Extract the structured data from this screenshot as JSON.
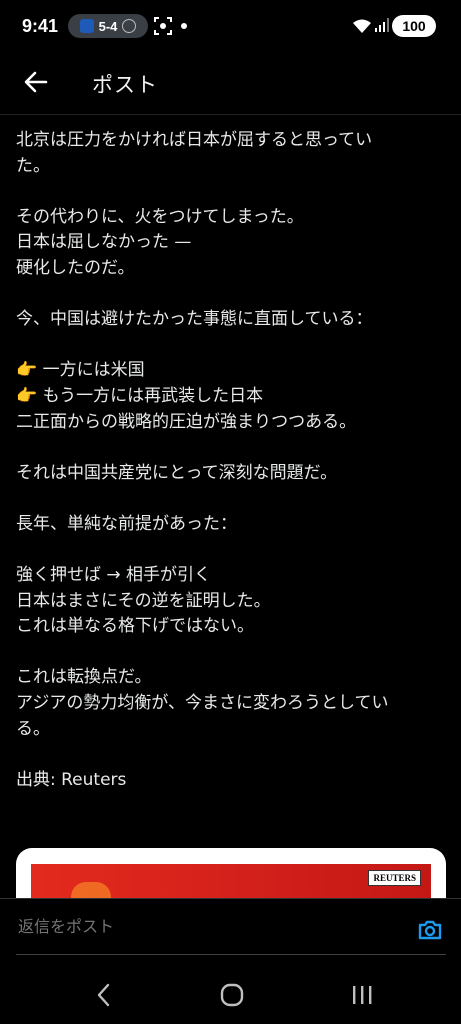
{
  "status_bar": {
    "time": "9:41",
    "score": "5-4",
    "battery": "100"
  },
  "header": {
    "title": "ポスト"
  },
  "post": {
    "paragraphs": [
      [
        "北京は圧力をかければ日本が屈すると思ってい",
        "た。"
      ],
      [
        "その代わりに、火をつけてしまった。",
        "日本は屈しなかった —",
        "硬化したのだ。"
      ],
      [
        "今、中国は避けたかった事態に直面している："
      ],
      [
        "一方には米国",
        "もう一方には再武装した日本",
        "二正面からの戦略的圧迫が強まりつつある。"
      ],
      [
        "それは中国共産党にとって深刻な問題だ。"
      ],
      [
        "長年、単純な前提があった："
      ],
      [
        "強く押せば → 相手が引く",
        "日本はまさにその逆を証明した。",
        "これは単なる格下げではない。"
      ],
      [
        "これは転換点だ。",
        "アジアの勢力均衡が、今まさに変わろうとしてい",
        "る。"
      ],
      [
        "出典: Reuters"
      ]
    ],
    "emoji_point": "👉"
  },
  "media": {
    "logo_text": "REUTERS"
  },
  "reply": {
    "placeholder": "返信をポスト"
  }
}
